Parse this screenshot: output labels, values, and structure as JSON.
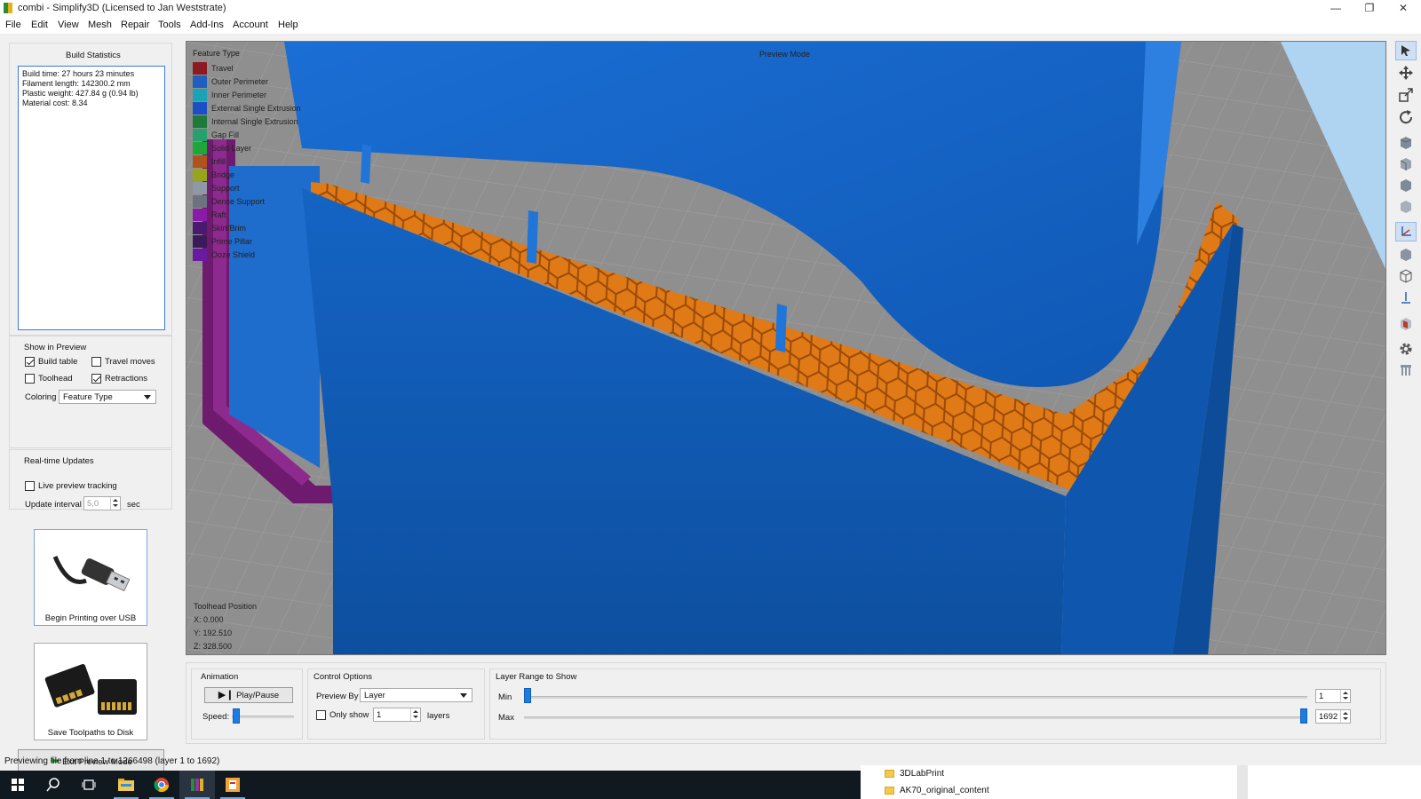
{
  "window": {
    "title": "combi - Simplify3D (Licensed to Jan Weststrate)",
    "controls": [
      "—",
      "❐",
      "✕"
    ]
  },
  "menu": [
    "File",
    "Edit",
    "View",
    "Mesh",
    "Repair",
    "Tools",
    "Add-Ins",
    "Account",
    "Help"
  ],
  "build_stats": {
    "title": "Build Statistics",
    "lines": [
      "Build time: 27 hours 23 minutes",
      "Filament length: 142300.2 mm",
      "Plastic weight: 427.84 g (0.94 lb)",
      "Material cost: 8.34"
    ]
  },
  "show_in_preview": {
    "title": "Show in Preview",
    "build_table": {
      "label": "Build table",
      "checked": true
    },
    "travel_moves": {
      "label": "Travel moves",
      "checked": false
    },
    "toolhead": {
      "label": "Toolhead",
      "checked": false
    },
    "retractions": {
      "label": "Retractions",
      "checked": true
    },
    "coloring_label": "Coloring",
    "coloring_value": "Feature Type"
  },
  "realtime": {
    "title": "Real-time Updates",
    "live_tracking": {
      "label": "Live preview tracking",
      "checked": false
    },
    "interval_label": "Update interval",
    "interval_value": "5,0",
    "interval_unit": "sec"
  },
  "buttons": {
    "usb": "Begin Printing over USB",
    "disk": "Save Toolpaths to Disk",
    "exit": "Exit Preview Mode"
  },
  "legend": {
    "title": "Feature Type",
    "items": [
      {
        "label": "Travel",
        "color": "#8b1a22"
      },
      {
        "label": "Outer Perimeter",
        "color": "#1f5fbf"
      },
      {
        "label": "Inner Perimeter",
        "color": "#1aa3b4"
      },
      {
        "label": "External Single Extrusion",
        "color": "#1d4fc4"
      },
      {
        "label": "Internal Single Extrusion",
        "color": "#1d7a3a"
      },
      {
        "label": "Gap Fill",
        "color": "#27a06b"
      },
      {
        "label": "Solid Layer",
        "color": "#1fa63a"
      },
      {
        "label": "Infill",
        "color": "#b0521e"
      },
      {
        "label": "Bridge",
        "color": "#9aa31c"
      },
      {
        "label": "Support",
        "color": "#8e98a8"
      },
      {
        "label": "Dense Support",
        "color": "#6b7280"
      },
      {
        "label": "Raft",
        "color": "#8a1aa8"
      },
      {
        "label": "Skirt/Brim",
        "color": "#4a1a6e"
      },
      {
        "label": "Prime Pillar",
        "color": "#3a1a5a"
      },
      {
        "label": "Ooze Shield",
        "color": "#6a1aa0"
      }
    ]
  },
  "viewport": {
    "mode_label": "Preview Mode",
    "toolhead_title": "Toolhead Position",
    "x": "X: 0.000",
    "y": "Y: 192.510",
    "z": "Z: 328.500"
  },
  "animation": {
    "title": "Animation",
    "play_label": "Play/Pause",
    "speed_label": "Speed:"
  },
  "control_options": {
    "title": "Control Options",
    "preview_by_label": "Preview By",
    "preview_by_value": "Layer",
    "only_show_label": "Only show",
    "only_show_value": "1",
    "layers_label": "layers"
  },
  "layer_range": {
    "title": "Layer Range to Show",
    "min_label": "Min",
    "max_label": "Max",
    "min_value": "1",
    "max_value": "1692",
    "total_layers": 1692
  },
  "status": "Previewing file from line 1 to 1266498 (layer 1 to 1692)",
  "explorer": {
    "folders": [
      "3DLabPrint",
      "AK70_original_content"
    ]
  },
  "colors": {
    "accent": "#1e7be0",
    "model_blue": "#1565c8",
    "infill_orange": "#e8801c",
    "raft_purple": "#6e1a6e"
  }
}
